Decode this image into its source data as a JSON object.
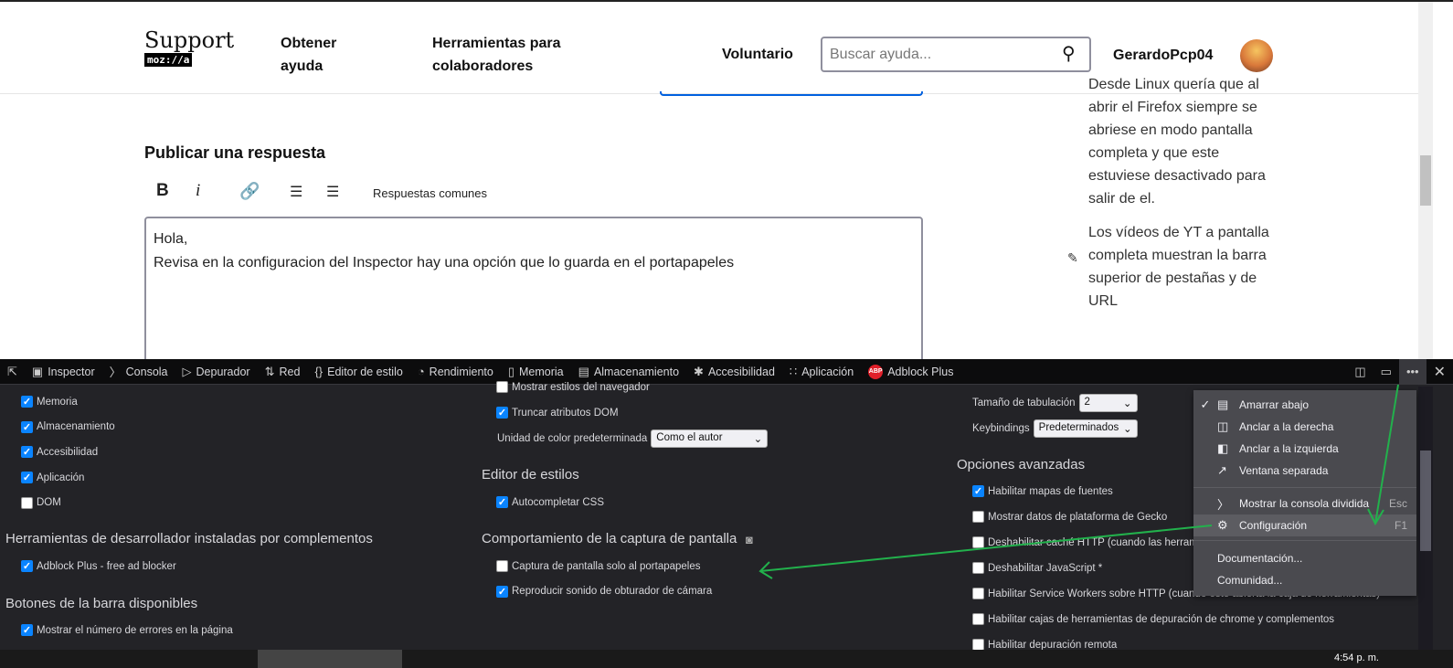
{
  "header": {
    "logo_text": "Support",
    "logo_sub": "moz://a",
    "nav": [
      "Obtener ayuda",
      "Herramientas para colaboradores",
      "Voluntario"
    ],
    "search_placeholder": "Buscar ayuda...",
    "username": "GerardoPcp04"
  },
  "sidebar": {
    "items": [
      "Desde Linux quería que al abrir el Firefox siempre se abriese en modo pantalla completa y que este estuviese desactivado para salir de el.",
      "Los vídeos de YT a pantalla completa muestran la barra superior de pestañas y de URL"
    ]
  },
  "reply": {
    "title": "Publicar una respuesta",
    "toolbar": {
      "bold": "B",
      "italic": "i",
      "common": "Respuestas comunes"
    },
    "lines": [
      "Hola,",
      "Revisa en la configuracion del Inspector hay una opción que lo guarda en el portapapeles"
    ]
  },
  "devtools": {
    "tabs": [
      "Inspector",
      "Consola",
      "Depurador",
      "Red",
      "Editor de estilo",
      "Rendimiento",
      "Memoria",
      "Almacenamiento",
      "Accesibilidad",
      "Aplicación",
      "Adblock Plus"
    ],
    "col1": {
      "tools": [
        {
          "label": "Memoria",
          "checked": true
        },
        {
          "label": "Almacenamiento",
          "checked": true
        },
        {
          "label": "Accesibilidad",
          "checked": true
        },
        {
          "label": "Aplicación",
          "checked": true
        },
        {
          "label": "DOM",
          "checked": false
        }
      ],
      "addons_title": "Herramientas de desarrollador instaladas por complementos",
      "addons": [
        {
          "label": "Adblock Plus - free ad blocker",
          "checked": true
        }
      ],
      "buttons_title": "Botones de la barra disponibles",
      "buttons": [
        {
          "label": "Mostrar el número de errores en la página",
          "checked": true
        }
      ]
    },
    "col2": {
      "inspector": [
        {
          "label": "Mostrar estilos del navegador",
          "checked": false
        },
        {
          "label": "Truncar atributos DOM",
          "checked": true
        }
      ],
      "color_unit_label": "Unidad de color predeterminada",
      "color_unit_value": "Como el autor",
      "style_title": "Editor de estilos",
      "style": [
        {
          "label": "Autocompletar CSS",
          "checked": true
        }
      ],
      "screenshot_title": "Comportamiento de la captura de pantalla",
      "screenshot": [
        {
          "label": "Captura de pantalla solo al portapapeles",
          "checked": false
        },
        {
          "label": "Reproducir sonido de obturador de cámara",
          "checked": true
        }
      ]
    },
    "col3": {
      "tab_size_label": "Tamaño de tabulación",
      "tab_size_value": "2",
      "keybindings_label": "Keybindings",
      "keybindings_value": "Predeterminados",
      "advanced_title": "Opciones avanzadas",
      "advanced": [
        {
          "label": "Habilitar mapas de fuentes",
          "checked": true
        },
        {
          "label": "Mostrar datos de plataforma de Gecko",
          "checked": false
        },
        {
          "label": "Deshabilitar caché HTTP (cuando las herramientas estén abiertas)",
          "checked": false
        },
        {
          "label": "Deshabilitar JavaScript *",
          "checked": false
        },
        {
          "label": "Habilitar Service Workers sobre HTTP (cuando esté abierta la caja de herramientas)",
          "checked": false
        },
        {
          "label": "Habilitar cajas de herramientas de depuración de chrome y complementos",
          "checked": false
        },
        {
          "label": "Habilitar depuración remota",
          "checked": false
        }
      ]
    },
    "menu": {
      "items": [
        {
          "label": "Amarrar abajo",
          "checked": true,
          "icon": "dock-bottom-icon"
        },
        {
          "label": "Anclar a la derecha",
          "icon": "dock-right-icon"
        },
        {
          "label": "Anclar a la izquierda",
          "icon": "dock-left-icon"
        },
        {
          "label": "Ventana separada",
          "icon": "window-icon"
        }
      ],
      "split_console": "Mostrar la consola dividida",
      "split_key": "Esc",
      "settings": "Configuración",
      "settings_key": "F1",
      "docs": "Documentación...",
      "community": "Comunidad..."
    }
  },
  "taskbar": {
    "time": "4:54 p. m."
  },
  "colors": {
    "accent": "#0a84ff",
    "arrow": "#22b14c",
    "devtools_bg": "#232327"
  }
}
